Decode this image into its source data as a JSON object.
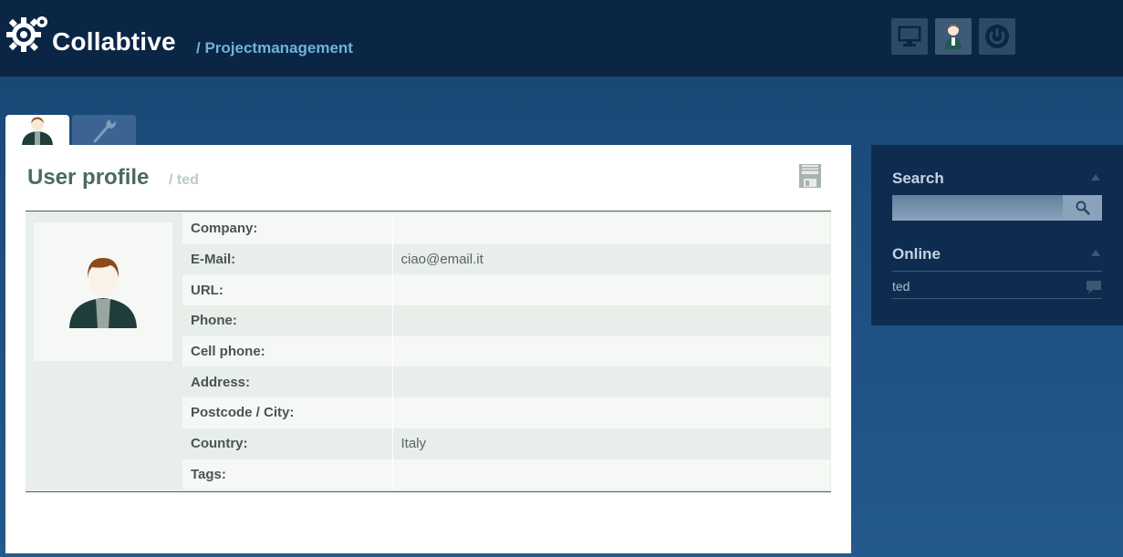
{
  "header": {
    "brand": "Collabtive",
    "subbrand": "/ Projectmanagement",
    "buttons": [
      "desktop-icon",
      "user-icon",
      "power-icon"
    ]
  },
  "tabs": [
    {
      "icon": "user-avatar-icon",
      "active": true
    },
    {
      "icon": "wrench-icon",
      "active": false
    }
  ],
  "main": {
    "title": "User profile",
    "subtitle": "/ ted",
    "save_icon": "floppy-disk-icon",
    "fields": [
      {
        "label": "Company:",
        "value": ""
      },
      {
        "label": "E-Mail:",
        "value": "ciao@email.it"
      },
      {
        "label": "URL:",
        "value": ""
      },
      {
        "label": "Phone:",
        "value": ""
      },
      {
        "label": "Cell phone:",
        "value": ""
      },
      {
        "label": "Address:",
        "value": ""
      },
      {
        "label": "Postcode / City:",
        "value": ""
      },
      {
        "label": "Country:",
        "value": "Italy"
      },
      {
        "label": "Tags:",
        "value": ""
      }
    ]
  },
  "sidebar": {
    "search": {
      "title": "Search",
      "placeholder": "",
      "icon": "magnifier-icon"
    },
    "online": {
      "title": "Online",
      "users": [
        "ted"
      ],
      "icon": "chat-bubble-icon"
    }
  },
  "colors": {
    "header_bg": "#0b2545",
    "brand_accent": "#6fb3d9",
    "title_green": "#4a6b5e",
    "sidebar_bg": "#0e2c4f"
  }
}
